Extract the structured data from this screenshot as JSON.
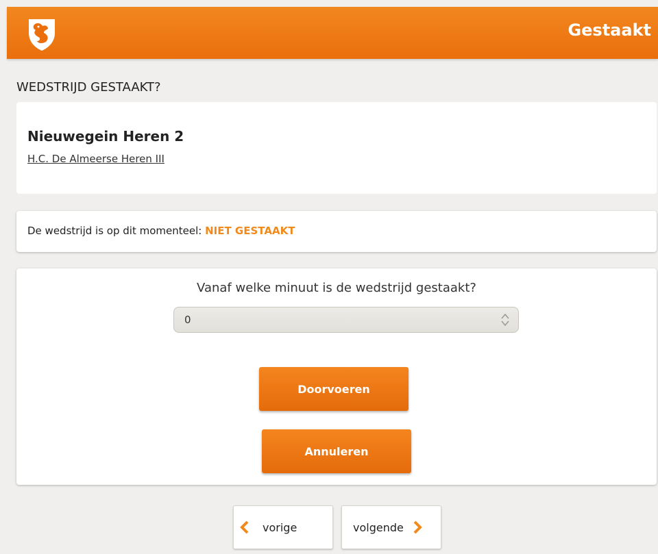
{
  "header": {
    "title": "Gestaakt",
    "logo": "lion-crest-logo",
    "color": "#ee7a14"
  },
  "section": {
    "heading": "WEDSTRIJD GESTAAKT?"
  },
  "match": {
    "home_team": "Nieuwegein Heren 2",
    "away_team": "H.C. De Almeerse Heren III"
  },
  "status": {
    "label": "De wedstrijd is op dit momenteel:",
    "value": "NIET GESTAAKT",
    "value_color": "#f08a1c"
  },
  "form": {
    "question": "Vanaf welke minuut is de wedstrijd gestaakt?",
    "minute_value": "0",
    "confirm_label": "Doorvoeren",
    "cancel_label": "Annuleren"
  },
  "navigation": {
    "prev_label": "vorige",
    "next_label": "volgende",
    "chevron_color": "#f08a1c"
  }
}
